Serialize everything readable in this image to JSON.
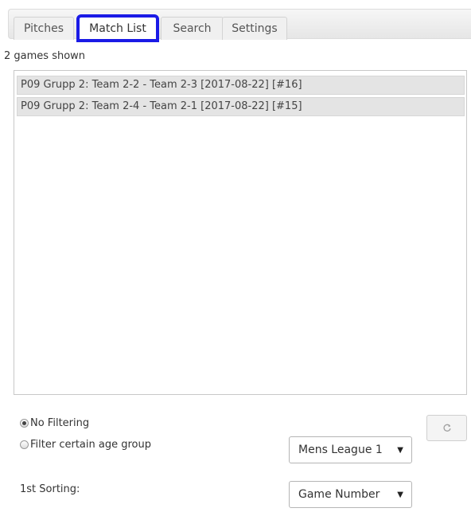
{
  "tabs": [
    {
      "label": "Pitches",
      "active": false
    },
    {
      "label": "Match List",
      "active": true
    },
    {
      "label": "Search",
      "active": false
    },
    {
      "label": "Settings",
      "active": false
    }
  ],
  "status": "2 games shown",
  "matches": [
    "P09 Grupp 2: Team 2-2 - Team 2-3 [2017-08-22] [#16]",
    "P09 Grupp 2: Team 2-4 - Team 2-1 [2017-08-22] [#15]"
  ],
  "filter": {
    "options": [
      "No Filtering",
      "Filter certain age group"
    ],
    "selected": "No Filtering",
    "age_group": "Mens League 1"
  },
  "sorting": {
    "label": "1st Sorting:",
    "value": "Game Number"
  },
  "icons": {
    "refresh": "refresh-icon",
    "dropdown": "caret-down-icon"
  },
  "colors": {
    "active_tab_highlight": "#1a1ae6",
    "row_background": "#e4e4e4"
  }
}
